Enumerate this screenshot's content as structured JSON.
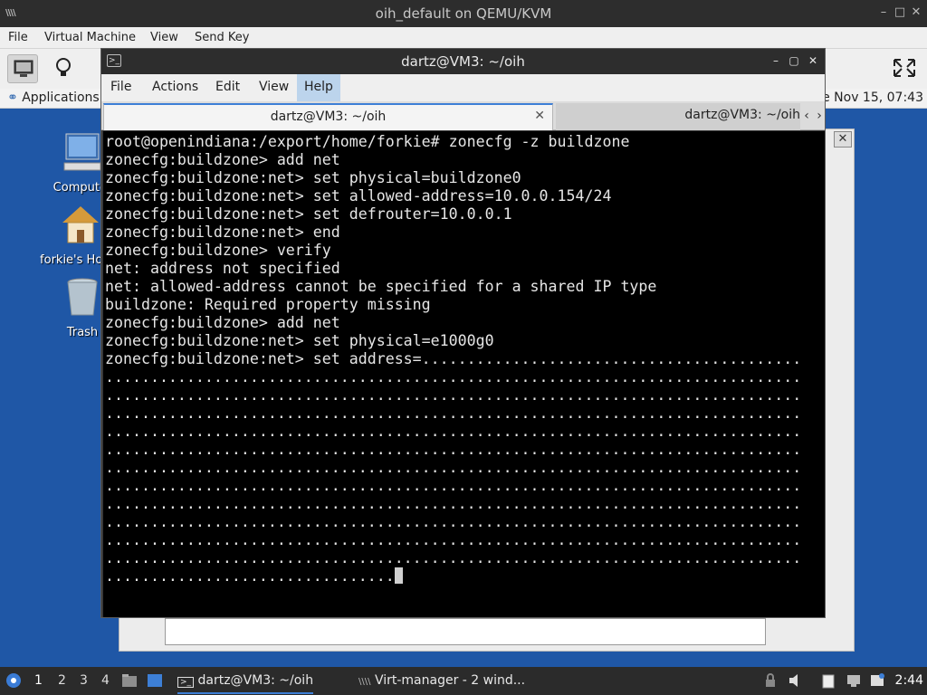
{
  "outer_window": {
    "title": "oih_default on QEMU/KVM",
    "app_icon": "\\\\\\\\",
    "menu": [
      "File",
      "Virtual Machine",
      "View",
      "Send Key"
    ]
  },
  "guest_panel": {
    "applications_label": "Applications",
    "clock": "Tue Nov 15, 07:43"
  },
  "desktop_icons": [
    {
      "label": "Computer",
      "icon": "monitor-icon"
    },
    {
      "label": "forkie's Home",
      "icon": "home-icon"
    },
    {
      "label": "Trash",
      "icon": "trash-icon"
    }
  ],
  "terminal": {
    "title": "dartz@VM3: ~/oih",
    "menu": [
      "File",
      "Actions",
      "Edit",
      "View",
      "Help"
    ],
    "active_menu": "Help",
    "tabs": [
      {
        "label": "dartz@VM3: ~/oih",
        "active": true
      },
      {
        "label": "dartz@VM3: ~/oih",
        "active": false
      }
    ],
    "lines": [
      "root@openindiana:/export/home/forkie# zonecfg -z buildzone",
      "zonecfg:buildzone> add net",
      "zonecfg:buildzone:net> set physical=buildzone0",
      "zonecfg:buildzone:net> set allowed-address=10.0.0.154/24",
      "zonecfg:buildzone:net> set defrouter=10.0.0.1",
      "zonecfg:buildzone:net> end",
      "zonecfg:buildzone> verify",
      "net: address not specified",
      "net: allowed-address cannot be specified for a shared IP type",
      "buildzone: Required property missing",
      "zonecfg:buildzone> add net",
      "zonecfg:buildzone:net> set physical=e1000g0",
      "zonecfg:buildzone:net> set address=..........................................",
      ".............................................................................",
      ".............................................................................",
      ".............................................................................",
      ".............................................................................",
      ".............................................................................",
      ".............................................................................",
      ".............................................................................",
      ".............................................................................",
      ".............................................................................",
      ".............................................................................",
      ".............................................................................",
      "................................"
    ]
  },
  "taskbar": {
    "workspaces": [
      "1",
      "2",
      "3",
      "4"
    ],
    "active_workspace": "1",
    "tasks": [
      {
        "label": "dartz@VM3: ~/oih",
        "active": true
      },
      {
        "label": "Virt-manager - 2 wind...",
        "active": false
      }
    ],
    "clock": "2:44"
  }
}
